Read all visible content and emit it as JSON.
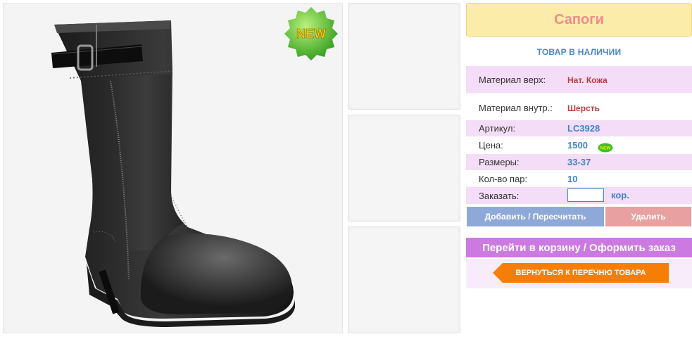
{
  "product": {
    "title": "Сапоги",
    "stock_status": "ТОВАР В НАЛИЧИИ",
    "badge_text": "NEW",
    "mini_badge_text": "NEW"
  },
  "details": [
    {
      "label": "Материал верх:",
      "value": "Нат. Кожа"
    },
    {
      "label": "Материал внутр.:",
      "value": "Шерсть"
    },
    {
      "label": "Артикул:",
      "value": "LC3928"
    },
    {
      "label": "Цена:",
      "value": "1500"
    },
    {
      "label": "Размеры:",
      "value": "33-37"
    },
    {
      "label": "Кол-во пар:",
      "value": "10"
    }
  ],
  "order": {
    "label": "Заказать:",
    "input_value": "",
    "unit": "кор."
  },
  "buttons": {
    "add": "Добавить / Пересчитать",
    "delete": "Удалить",
    "cart": "Перейти в корзину / Оформить заказ",
    "back": "ВЕРНУТЬСЯ К ПЕРЕЧНЮ ТОВАРА"
  },
  "icons": {
    "main_image": "black-leather-boot-photo",
    "new_badge": "new-star-badge-icon",
    "back_arrow": "arrow-left-icon"
  },
  "colors": {
    "title_bg": "#fcecaa",
    "title_text": "#ee8c8c",
    "row_pink": "#f4ddf6",
    "link_blue": "#3f84d2",
    "value_red": "#c23b3b",
    "add_button": "#8ea9d8",
    "delete_button": "#e8a0a0",
    "cart_button": "#cc7ae2",
    "back_button": "#f77e06"
  }
}
